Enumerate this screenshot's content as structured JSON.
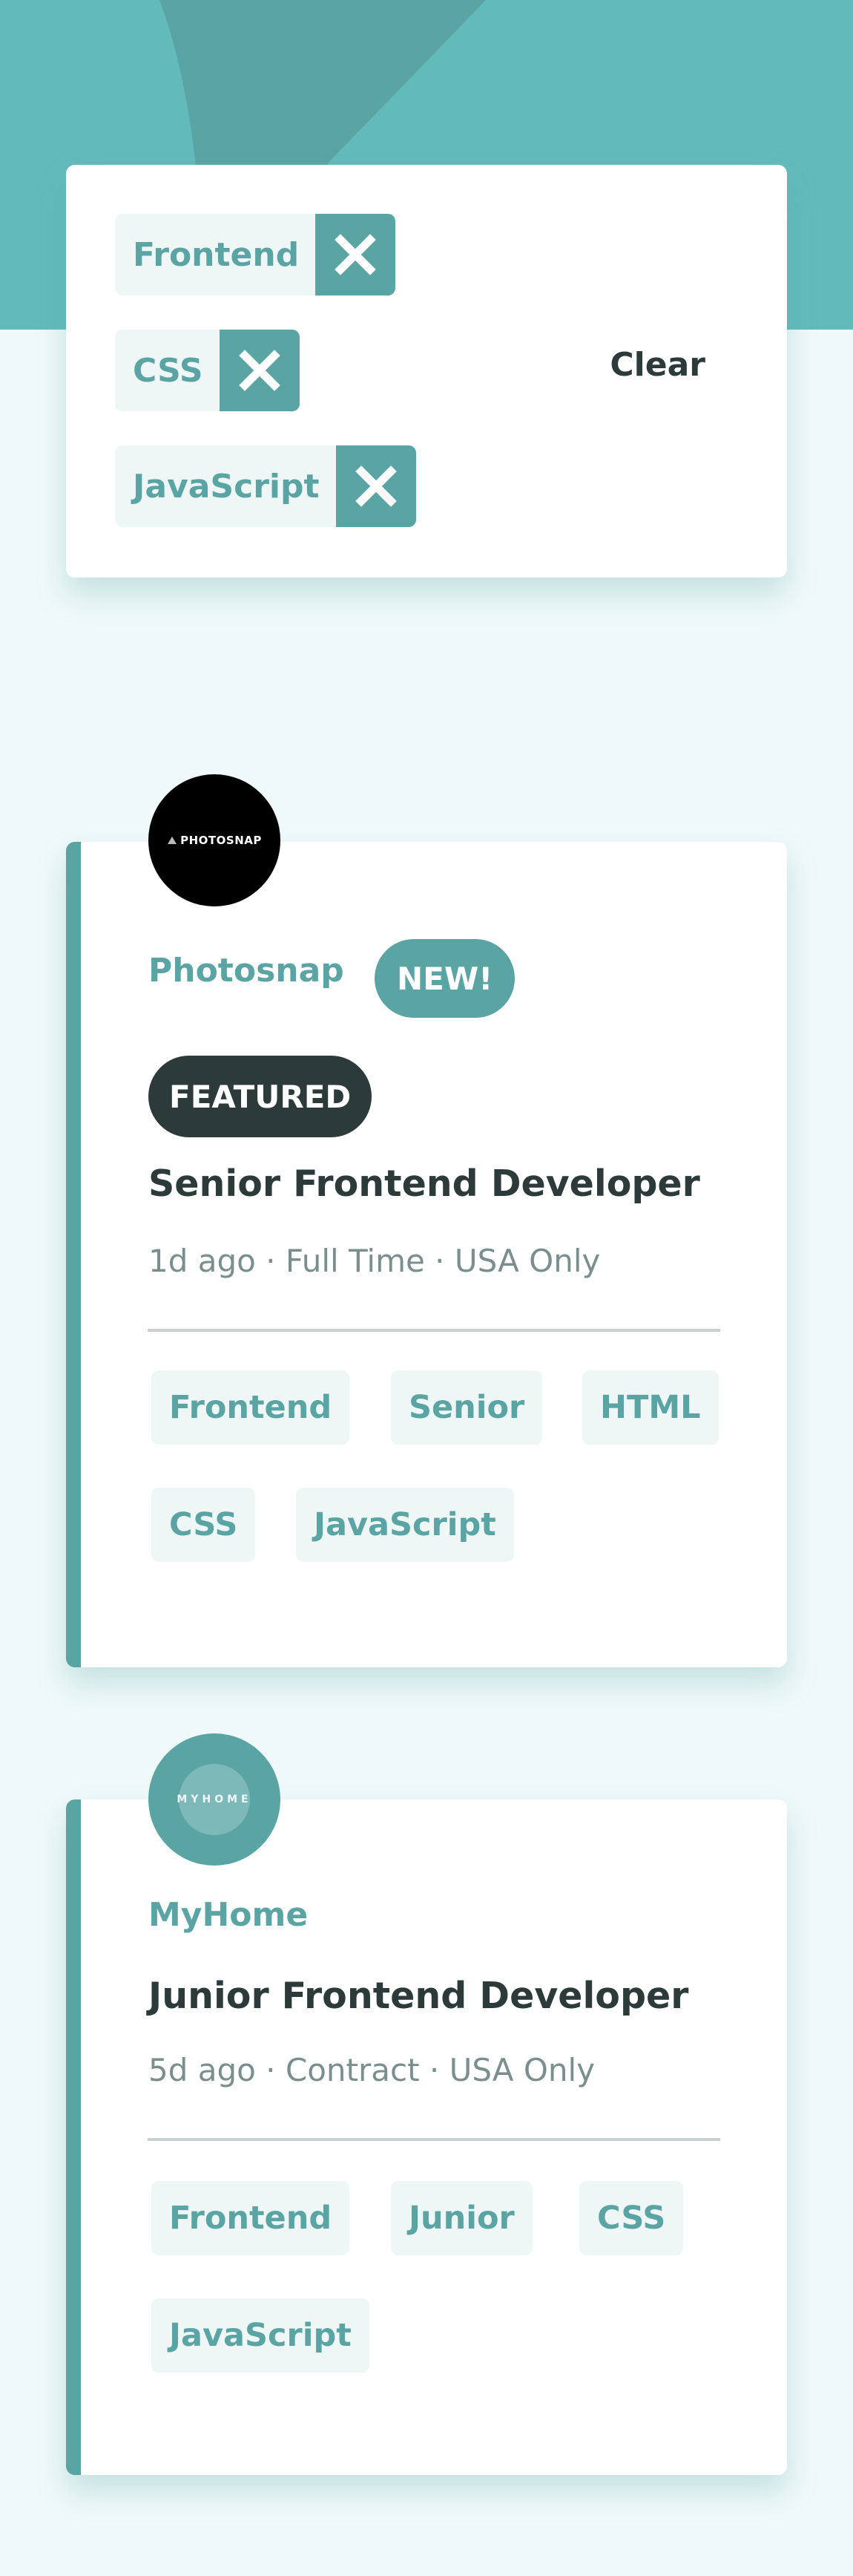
{
  "filters": {
    "tags": [
      "Frontend",
      "CSS",
      "JavaScript"
    ],
    "clear_label": "Clear"
  },
  "jobs": [
    {
      "company": "Photosnap",
      "logo_text": "PHOTOSNAP",
      "new_badge": "NEW!",
      "featured_badge": "FEATURED",
      "position": "Senior Frontend Developer",
      "meta": "1d ago · Full Time · USA Only",
      "tags": [
        "Frontend",
        "Senior",
        "HTML",
        "CSS",
        "JavaScript"
      ]
    },
    {
      "company": "MyHome",
      "logo_text": "MYHOME",
      "position": "Junior Frontend Developer",
      "meta": "5d ago · Contract · USA Only",
      "tags": [
        "Frontend",
        "Junior",
        "CSS",
        "JavaScript"
      ]
    }
  ],
  "colors": {
    "primary": "#5ba4a4",
    "header_bg": "#63babb",
    "page_bg": "#eff9f9",
    "dark": "#2c3a3a",
    "tag_bg": "#eff6f6"
  }
}
